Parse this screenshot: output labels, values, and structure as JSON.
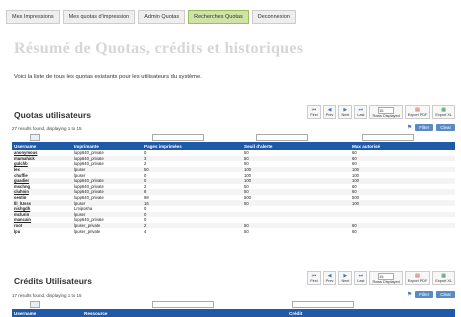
{
  "tabs": [
    {
      "label": "Mes Impressions",
      "active": false
    },
    {
      "label": "Mes quotas d'impression",
      "active": false
    },
    {
      "label": "Admin Quotas",
      "active": false
    },
    {
      "label": "Recherches Quotas",
      "active": true
    },
    {
      "label": "Deconnexion",
      "active": false
    }
  ],
  "hero_title": "Résumé de Quotas, crédits et historiques",
  "intro": "Voici la liste de tous les quotas existants pour les utilisateurs du système.",
  "quotas": {
    "title": "Quotas utilisateurs",
    "found": "27 results found, displaying 1 to 15",
    "filter_label": "Filter",
    "clear_label": "Clear",
    "pager": {
      "first": "First",
      "prev": "Prev",
      "next": "Next",
      "last": "Last",
      "rows_label": "Rows Displayed",
      "rows_value": "15",
      "export_pdf": "Export PDF",
      "export_xls": "Export XL"
    },
    "columns": [
      "Username",
      "Imprimante",
      "Pages imprimées",
      "Seuil d'alerte",
      "Max autorisé"
    ],
    "rows": [
      [
        "anonymous",
        "lupp640_private",
        "0",
        "50",
        "60"
      ],
      [
        "mumahick",
        "lupp640_private",
        "3",
        "50",
        "60"
      ],
      [
        "gulchb",
        "lupp640_private",
        "2",
        "50",
        "60"
      ],
      [
        "lex",
        "lpuser",
        "50",
        "100",
        "100"
      ],
      [
        "chuffie",
        "lpuser",
        "0",
        "100",
        "100"
      ],
      [
        "guadier",
        "lupp640_private",
        "0",
        "100",
        "100"
      ],
      [
        "mschng",
        "lupp640_private",
        "2",
        "50",
        "60"
      ],
      [
        "cluhnin",
        "lupp640_private",
        "8",
        "50",
        "60"
      ],
      [
        "sentin",
        "lupp640_private",
        "98",
        "500",
        "500"
      ],
      [
        "lll_lUsss",
        "lpuser",
        "16",
        "50",
        "100"
      ],
      [
        "nichgdh",
        "Lmiposha",
        "0",
        "",
        ""
      ],
      [
        "mclurin",
        "lpuser",
        "0",
        "",
        ""
      ],
      [
        "mancain",
        "lupp640_private",
        "0",
        "",
        ""
      ],
      [
        "root",
        "lpuser_private",
        "2",
        "50",
        "60"
      ],
      [
        "lpu",
        "lpuser_private",
        "4",
        "50",
        "60"
      ]
    ]
  },
  "credits": {
    "title": "Crédits Utilisateurs",
    "found": "17 results found, displaying 1 to 15",
    "filter_label": "Filter",
    "clear_label": "Clear",
    "pager": {
      "first": "First",
      "prev": "Prev",
      "next": "Next",
      "last": "Last",
      "rows_label": "Rows Displayed",
      "rows_value": "15",
      "export_pdf": "Export PDF",
      "export_xls": "Export XL"
    },
    "columns": [
      "Username",
      "Ressource",
      "Crédit"
    ]
  },
  "colors": {
    "header_blue": "#1f5aa8",
    "active_tab": "#cfe3a6"
  }
}
